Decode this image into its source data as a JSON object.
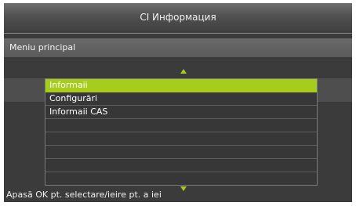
{
  "header": {
    "title": "CI Информация"
  },
  "subheader": {
    "title": "Meniu principal"
  },
  "menu": {
    "items": [
      {
        "label": "Informaii",
        "selected": true
      },
      {
        "label": "Configurări",
        "selected": false
      },
      {
        "label": "Informaii CAS",
        "selected": false
      },
      {
        "label": "",
        "selected": false
      },
      {
        "label": "",
        "selected": false
      },
      {
        "label": "",
        "selected": false
      },
      {
        "label": "",
        "selected": false
      },
      {
        "label": "",
        "selected": false
      }
    ]
  },
  "footer": {
    "hint": "Apasă OK pt. selectare/ieire pt. a iei"
  },
  "colors": {
    "accent": "#a6cc1c",
    "background": "#3b3b3b"
  },
  "icons": {
    "scroll_up": "triangle-up-icon",
    "scroll_down": "triangle-down-icon"
  }
}
